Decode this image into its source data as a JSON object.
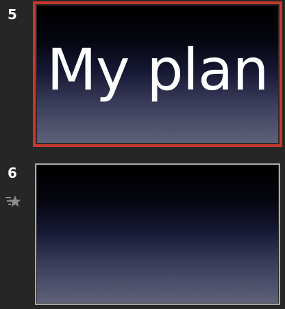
{
  "slides": [
    {
      "number": "5",
      "title": "My plan",
      "selected": true
    },
    {
      "number": "6",
      "title": "",
      "selected": false,
      "has_animation_icon": true
    }
  ],
  "icons": {
    "animation": "star-transition-icon"
  },
  "colors": {
    "panel_bg": "#262626",
    "selection_border": "#c7382c",
    "thumb_border": "#a9a9a9",
    "slide_gradient_top": "#000000",
    "slide_gradient_bottom": "#5f6079"
  }
}
